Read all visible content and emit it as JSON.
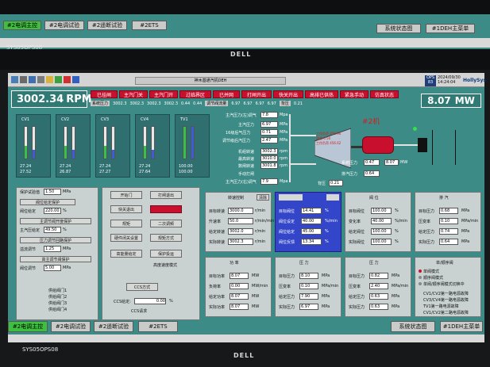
{
  "top_tabs": [
    "#2电调主控",
    "#2电调试验",
    "#2遥断试验",
    "#2ETS"
  ],
  "top_right_tabs": [
    "系统状态图",
    "#1DEH主菜单"
  ],
  "monitor_label": "SYS05OPS08",
  "brand": "DELL",
  "main": {
    "title": "神木基通汽机DEH",
    "rpm_value": "3002.34",
    "rpm_unit": "RPM",
    "mw_value": "8.07",
    "mw_unit": "MW",
    "ops_label": "OPS",
    "ops_num": "83",
    "date": "2024/09/30",
    "time": "14:24:04",
    "holysys": "HollySys",
    "status_buttons": [
      "已挂闸",
      "主汽门关",
      "主汽门开",
      "过临界区",
      "已并网",
      "打闸开出",
      "快关开出",
      "高排已供热",
      "紧急手动",
      "仿真状态"
    ],
    "sys_pressure_label": "系统压力",
    "sys_pressure_values": [
      "3002.3",
      "3002.3",
      "3002.3",
      "3002.3",
      "3002.3",
      "0.44",
      "0.44"
    ],
    "valve_flow_label": "调节阀流量",
    "valve_flow_values": [
      "6.97",
      "6.97",
      "6.97",
      "6.97"
    ],
    "bottom_pressure_label": "背压",
    "bottom_pressure_value": "0.21"
  },
  "cv": [
    {
      "name": "CV1",
      "v1": "27.24",
      "v2": "27.52"
    },
    {
      "name": "CV2",
      "v1": "27.24",
      "v2": "26.87"
    },
    {
      "name": "CV3",
      "v1": "27.24",
      "v2": "27.27"
    },
    {
      "name": "CV4",
      "v1": "27.24",
      "v2": "27.64"
    },
    {
      "name": "TV1",
      "v1": "100.00",
      "v2": "100.00"
    }
  ],
  "steam": {
    "machine_label": "#2机",
    "rows": [
      {
        "label": "主汽压力(左)调气",
        "value": "7.8",
        "unit": "Mpa"
      },
      {
        "label": "主汽压力",
        "value": "6.97",
        "unit": "MPa"
      },
      {
        "label": "16级后气压力",
        "value": "0.71",
        "unit": "MPa"
      },
      {
        "label": "调节级后汽压力",
        "value": "2.47",
        "unit": "MPa"
      },
      {
        "label": "机组转速",
        "value": "3002.3",
        "unit": "rpm"
      },
      {
        "label": "最高转速",
        "value": "3010.0",
        "unit": "rpm"
      },
      {
        "label": "数闸转速",
        "value": "3001.8",
        "unit": "rpm"
      },
      {
        "label": "手动打闸",
        "value": "",
        "unit": ""
      },
      {
        "label": "主汽压力(右)调气",
        "value": "7.9",
        "unit": "Mpa"
      }
    ],
    "turbine_lines": [
      "工作负荷",
      "456.96",
      "速度",
      "0.50",
      "工作负荷",
      "456.62"
    ],
    "grid_label": "主网负荷",
    "system_pressure": "系统压力",
    "system_pressure_val": "0.47",
    "exhaust_pressure": "排汽压力",
    "exhaust_pressure_val": "0.64",
    "back_pressure": "背压",
    "back_pressure_val": "0.21",
    "mw_small": "8.07",
    "mw_small_unit": "MW"
  },
  "left_panel": {
    "rows": [
      {
        "label": "保护试验值",
        "value": "1.50",
        "unit": "MPa"
      },
      {
        "label": "阀位给定",
        "value": "220.00",
        "unit": "%"
      }
    ],
    "checks": [
      "阀位给定保护",
      "主调节阀开度保护",
      "压力调节回路保护",
      "高主调节阀保护"
    ],
    "labels2": [
      {
        "label": "主汽压给定",
        "value": "49.50",
        "unit": "%"
      },
      {
        "label": "溢流调节",
        "value": "1.25",
        "unit": "MPa"
      },
      {
        "label": "阀位调节",
        "value": "5.00",
        "unit": "MPa"
      }
    ],
    "bottom_items": [
      "供给阀门1",
      "供给阀门2",
      "供给阀门3",
      "供给阀门4"
    ]
  },
  "mid_buttons": {
    "b1": "开始门",
    "b2": "打闸退出",
    "b3": "快关退出",
    "b4": "",
    "b5": "规矩",
    "b6": "二次调频",
    "b7": "硬件闭关设置",
    "b8": "规矩方式",
    "b9": "高能量给定",
    "b10": "保护投运",
    "b11": "",
    "b12": "高度速度模式",
    "b13": "CCS方式",
    "ccs_label": "CCS给定:",
    "ccs_value": "0.00",
    "ccs_unit": "%",
    "ccs_req": "CCS请求"
  },
  "speed_panel": {
    "header": "转速控制",
    "header_btn": "清除",
    "rows": [
      {
        "label": "目标转速",
        "value": "3000.0",
        "unit": "r/min"
      },
      {
        "label": "升速率",
        "value": "50.0",
        "unit": "r/min/min"
      },
      {
        "label": "给定转速",
        "value": "3002.0",
        "unit": "r/min"
      },
      {
        "label": "实际转速",
        "value": "3002.3",
        "unit": "r/min"
      }
    ]
  },
  "blue_panel": {
    "rows": [
      {
        "label": "目标阀位",
        "value": "14.41",
        "unit": "%"
      },
      {
        "label": "阀位设定",
        "value": "40.00",
        "unit": "%/min"
      },
      {
        "label": "阀位给定",
        "value": "45.00",
        "unit": "%"
      },
      {
        "label": "阀位反馈",
        "value": "13.34",
        "unit": "%"
      }
    ]
  },
  "valve_panel": {
    "header": "阀 位",
    "rows": [
      {
        "label": "目标阀位",
        "value": "100.00",
        "unit": "%"
      },
      {
        "label": "变化率",
        "value": "40.00",
        "unit": "%/min"
      },
      {
        "label": "给定阀位",
        "value": "100.00",
        "unit": "%"
      },
      {
        "label": "实际阀位",
        "value": "100.00",
        "unit": "%"
      }
    ]
  },
  "pressure_panel": {
    "header": "压 力",
    "rows": [
      {
        "label": "目标压力",
        "value": "8.10",
        "unit": "MPa"
      },
      {
        "label": "压变率",
        "value": "0.10",
        "unit": "MPa/min"
      },
      {
        "label": "给定压力",
        "value": "7.90",
        "unit": "MPa"
      },
      {
        "label": "实际压力",
        "value": "6.97",
        "unit": "MPa"
      }
    ]
  },
  "power_panel": {
    "header": "功 率",
    "rows": [
      {
        "label": "目标功率",
        "value": "8.07",
        "unit": "MW"
      },
      {
        "label": "负荷率",
        "value": "0.00",
        "unit": "MW/min"
      },
      {
        "label": "给定功率",
        "value": "8.07",
        "unit": "MW"
      },
      {
        "label": "实际功率",
        "value": "8.07",
        "unit": "MW"
      }
    ]
  },
  "mainpress_panel": {
    "header": "压 力",
    "rows": [
      {
        "label": "目标压力",
        "value": "0.82",
        "unit": "MPa"
      },
      {
        "label": "压变率",
        "value": "2.40",
        "unit": "MPa/min"
      },
      {
        "label": "给定压力",
        "value": "0.63",
        "unit": "MPa"
      },
      {
        "label": "实际压力",
        "value": "0.63",
        "unit": "MPa"
      }
    ]
  },
  "right_panel": {
    "header": "排 汽",
    "rows": [
      {
        "label": "目标压力",
        "value": "0.68",
        "unit": "MPa"
      },
      {
        "label": "压变率",
        "value": "0.10",
        "unit": "MPa/min"
      },
      {
        "label": "给定压力",
        "value": "0.74",
        "unit": "MPa"
      },
      {
        "label": "实际压力",
        "value": "0.64",
        "unit": "MPa"
      }
    ]
  },
  "mode_panel": {
    "header": "单/顺序阀",
    "options": [
      "单阀模式",
      "顺序阀模式",
      "单阀/顺序阀模式切换中"
    ],
    "list": [
      "CV1/CV2第一路电源故障",
      "CV3/CV4第一路电源故障",
      "TV1第一路电源故障",
      "CV1/CV2第二路电源故障"
    ]
  },
  "bottom_tabs": [
    "#2电调主控",
    "#2电调试验",
    "#2遥断试验",
    "#2ETS"
  ],
  "bottom_right_tabs": [
    "系统状态图",
    "#1DEH主菜单"
  ],
  "bottom_monitor_label": "SYS05OPS08",
  "bottom_brand": "DELL"
}
